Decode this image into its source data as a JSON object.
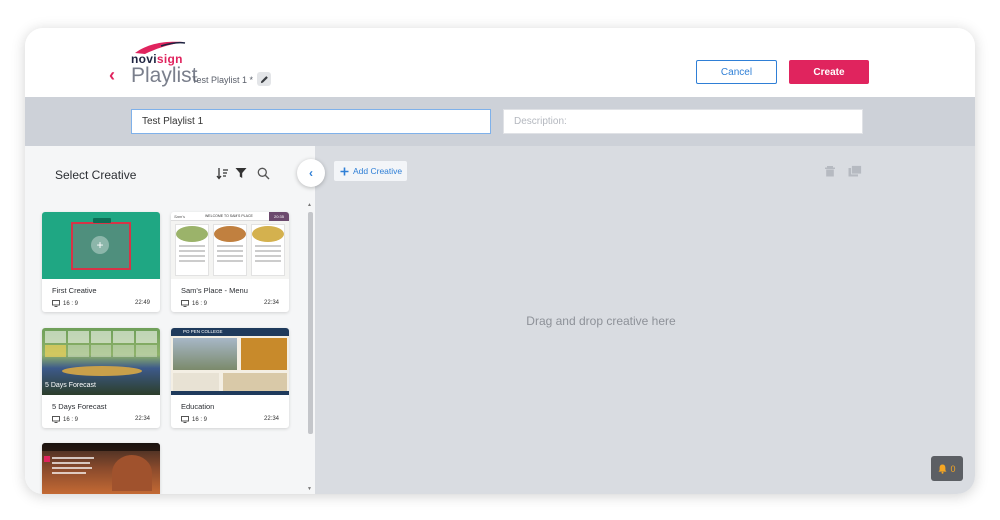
{
  "header": {
    "logo": {
      "part1": "novi",
      "part2": "sign"
    },
    "title": "Playlist",
    "subtitle": "Test Playlist 1 *",
    "cancel_label": "Cancel",
    "create_label": "Create"
  },
  "form": {
    "name_value": "Test Playlist 1",
    "description_placeholder": "Description:"
  },
  "left_panel": {
    "title": "Select Creative",
    "cards": [
      {
        "name": "First Creative",
        "ratio": "16 : 9",
        "duration": "22:49"
      },
      {
        "name": "Sam's Place - Menu",
        "ratio": "16 : 9",
        "duration": "22:34",
        "thumb_header": "WELCOME TO SAM'S PLACE",
        "thumb_time": "20:35"
      },
      {
        "name": "5 Days Forecast",
        "ratio": "16 : 9",
        "duration": "22:34",
        "thumb_caption": "5 Days Forecast"
      },
      {
        "name": "Education",
        "ratio": "16 : 9",
        "duration": "22:34",
        "thumb_header": "PO PEN COLLEGE"
      }
    ]
  },
  "right_panel": {
    "add_label": "Add Creative",
    "drop_text": "Drag and drop creative here",
    "notification_count": "0"
  },
  "colors": {
    "accent": "#e0245e",
    "link_blue": "#2f7fd6",
    "band": "#cdd1d8",
    "drop_area": "#d9dce1"
  }
}
